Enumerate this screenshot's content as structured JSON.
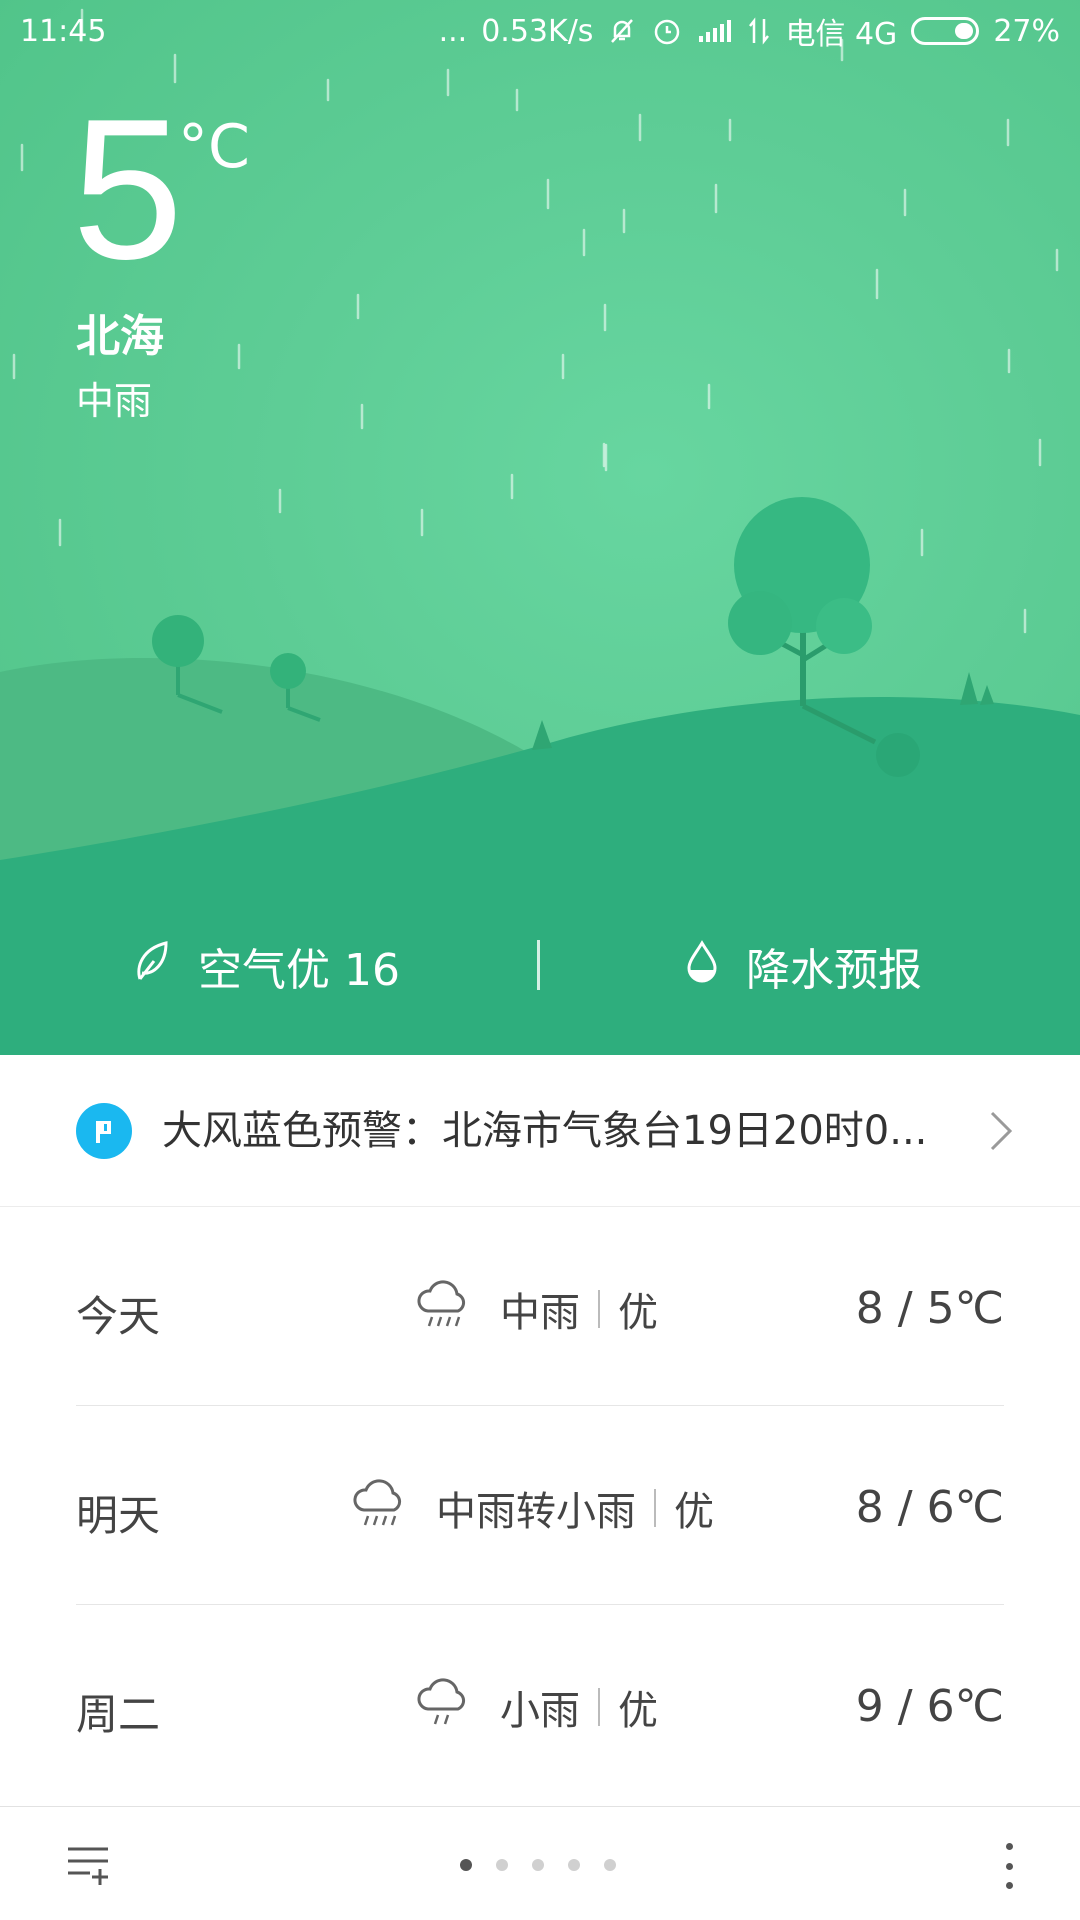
{
  "status_bar": {
    "time": "11:45",
    "dots": "...",
    "net_speed": "0.53K/s",
    "carrier": "电信 4G",
    "battery": "27%",
    "icons": [
      "mute-icon",
      "alarm-icon",
      "signal-icon",
      "data-icon",
      "battery-icon"
    ]
  },
  "current": {
    "temperature": "5",
    "unit": "°C",
    "city": "北海",
    "condition": "中雨"
  },
  "infobar": {
    "air_quality": "空气优 16",
    "precipitation": "降水预报"
  },
  "alert": {
    "text": "大风蓝色预警：北海市气象台19日20时0...",
    "icon_color": "#1ab8f0"
  },
  "forecast": [
    {
      "day": "今天",
      "weather": "中雨",
      "aqi": "优",
      "temps": "8 / 5℃",
      "icon": "rain-cloud-icon"
    },
    {
      "day": "明天",
      "weather": "中雨转小雨",
      "aqi": "优",
      "temps": "8 / 6℃",
      "icon": "rain-cloud-icon"
    },
    {
      "day": "周二",
      "weather": "小雨",
      "aqi": "优",
      "temps": "9 / 6℃",
      "icon": "light-rain-cloud-icon"
    }
  ],
  "pager": {
    "pages": 5,
    "active": 0
  },
  "colors": {
    "hero": "#5ecd96",
    "hill_dark": "#2eae7d",
    "accent_alert": "#1ab8f0"
  }
}
